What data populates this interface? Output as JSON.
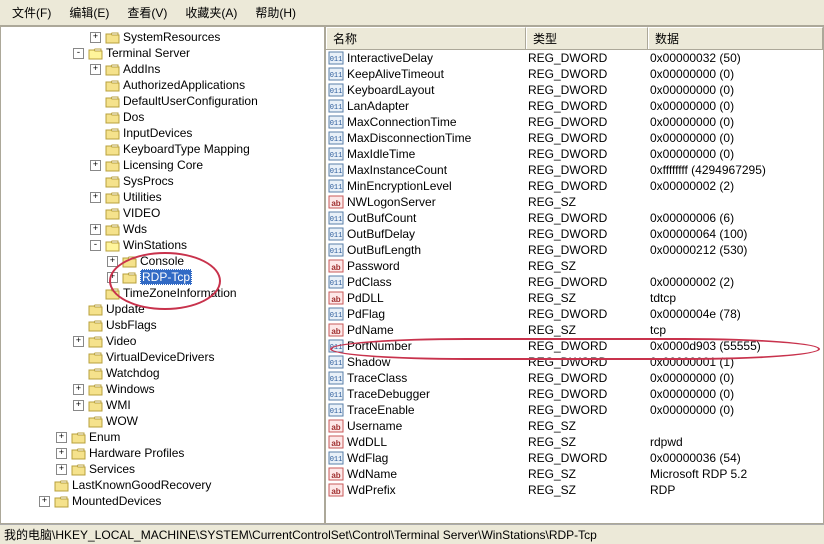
{
  "menu": {
    "file": "文件(F)",
    "edit": "编辑(E)",
    "view": "查看(V)",
    "favorites": "收藏夹(A)",
    "help": "帮助(H)"
  },
  "tree": [
    {
      "d": 5,
      "t": "+",
      "l": "SystemResources"
    },
    {
      "d": 4,
      "t": "-",
      "l": "Terminal Server"
    },
    {
      "d": 5,
      "t": "+",
      "l": "AddIns"
    },
    {
      "d": 5,
      "t": "",
      "l": "AuthorizedApplications"
    },
    {
      "d": 5,
      "t": "",
      "l": "DefaultUserConfiguration"
    },
    {
      "d": 5,
      "t": "",
      "l": "Dos"
    },
    {
      "d": 5,
      "t": "",
      "l": "InputDevices"
    },
    {
      "d": 5,
      "t": "",
      "l": "KeyboardType Mapping"
    },
    {
      "d": 5,
      "t": "+",
      "l": "Licensing Core"
    },
    {
      "d": 5,
      "t": "",
      "l": "SysProcs"
    },
    {
      "d": 5,
      "t": "+",
      "l": "Utilities"
    },
    {
      "d": 5,
      "t": "",
      "l": "VIDEO"
    },
    {
      "d": 5,
      "t": "+",
      "l": "Wds"
    },
    {
      "d": 5,
      "t": "-",
      "l": "WinStations"
    },
    {
      "d": 6,
      "t": "+",
      "l": "Console"
    },
    {
      "d": 6,
      "t": "+",
      "l": "RDP-Tcp",
      "sel": true
    },
    {
      "d": 5,
      "t": "",
      "l": "TimeZoneInformation"
    },
    {
      "d": 4,
      "t": "",
      "l": "Update"
    },
    {
      "d": 4,
      "t": "",
      "l": "UsbFlags"
    },
    {
      "d": 4,
      "t": "+",
      "l": "Video"
    },
    {
      "d": 4,
      "t": "",
      "l": "VirtualDeviceDrivers"
    },
    {
      "d": 4,
      "t": "",
      "l": "Watchdog"
    },
    {
      "d": 4,
      "t": "+",
      "l": "Windows"
    },
    {
      "d": 4,
      "t": "+",
      "l": "WMI"
    },
    {
      "d": 4,
      "t": "",
      "l": "WOW"
    },
    {
      "d": 3,
      "t": "+",
      "l": "Enum"
    },
    {
      "d": 3,
      "t": "+",
      "l": "Hardware Profiles"
    },
    {
      "d": 3,
      "t": "+",
      "l": "Services"
    },
    {
      "d": 2,
      "t": "",
      "l": "LastKnownGoodRecovery"
    },
    {
      "d": 2,
      "t": "+",
      "l": "MountedDevices"
    }
  ],
  "columns": {
    "name": "名称",
    "type": "类型",
    "data": "数据"
  },
  "values": [
    {
      "n": "InteractiveDelay",
      "t": "REG_DWORD",
      "d": "0x00000032 (50)",
      "k": "num"
    },
    {
      "n": "KeepAliveTimeout",
      "t": "REG_DWORD",
      "d": "0x00000000 (0)",
      "k": "num"
    },
    {
      "n": "KeyboardLayout",
      "t": "REG_DWORD",
      "d": "0x00000000 (0)",
      "k": "num"
    },
    {
      "n": "LanAdapter",
      "t": "REG_DWORD",
      "d": "0x00000000 (0)",
      "k": "num"
    },
    {
      "n": "MaxConnectionTime",
      "t": "REG_DWORD",
      "d": "0x00000000 (0)",
      "k": "num"
    },
    {
      "n": "MaxDisconnectionTime",
      "t": "REG_DWORD",
      "d": "0x00000000 (0)",
      "k": "num"
    },
    {
      "n": "MaxIdleTime",
      "t": "REG_DWORD",
      "d": "0x00000000 (0)",
      "k": "num"
    },
    {
      "n": "MaxInstanceCount",
      "t": "REG_DWORD",
      "d": "0xffffffff (4294967295)",
      "k": "num"
    },
    {
      "n": "MinEncryptionLevel",
      "t": "REG_DWORD",
      "d": "0x00000002 (2)",
      "k": "num"
    },
    {
      "n": "NWLogonServer",
      "t": "REG_SZ",
      "d": "",
      "k": "str"
    },
    {
      "n": "OutBufCount",
      "t": "REG_DWORD",
      "d": "0x00000006 (6)",
      "k": "num"
    },
    {
      "n": "OutBufDelay",
      "t": "REG_DWORD",
      "d": "0x00000064 (100)",
      "k": "num"
    },
    {
      "n": "OutBufLength",
      "t": "REG_DWORD",
      "d": "0x00000212 (530)",
      "k": "num"
    },
    {
      "n": "Password",
      "t": "REG_SZ",
      "d": "",
      "k": "str"
    },
    {
      "n": "PdClass",
      "t": "REG_DWORD",
      "d": "0x00000002 (2)",
      "k": "num"
    },
    {
      "n": "PdDLL",
      "t": "REG_SZ",
      "d": "tdtcp",
      "k": "str"
    },
    {
      "n": "PdFlag",
      "t": "REG_DWORD",
      "d": "0x0000004e (78)",
      "k": "num"
    },
    {
      "n": "PdName",
      "t": "REG_SZ",
      "d": "tcp",
      "k": "str"
    },
    {
      "n": "PortNumber",
      "t": "REG_DWORD",
      "d": "0x0000d903 (55555)",
      "k": "num"
    },
    {
      "n": "Shadow",
      "t": "REG_DWORD",
      "d": "0x00000001 (1)",
      "k": "num"
    },
    {
      "n": "TraceClass",
      "t": "REG_DWORD",
      "d": "0x00000000 (0)",
      "k": "num"
    },
    {
      "n": "TraceDebugger",
      "t": "REG_DWORD",
      "d": "0x00000000 (0)",
      "k": "num"
    },
    {
      "n": "TraceEnable",
      "t": "REG_DWORD",
      "d": "0x00000000 (0)",
      "k": "num"
    },
    {
      "n": "Username",
      "t": "REG_SZ",
      "d": "",
      "k": "str"
    },
    {
      "n": "WdDLL",
      "t": "REG_SZ",
      "d": "rdpwd",
      "k": "str"
    },
    {
      "n": "WdFlag",
      "t": "REG_DWORD",
      "d": "0x00000036 (54)",
      "k": "num"
    },
    {
      "n": "WdName",
      "t": "REG_SZ",
      "d": "Microsoft RDP 5.2",
      "k": "str"
    },
    {
      "n": "WdPrefix",
      "t": "REG_SZ",
      "d": "RDP",
      "k": "str"
    }
  ],
  "statusbar": "我的电脑\\HKEY_LOCAL_MACHINE\\SYSTEM\\CurrentControlSet\\Control\\Terminal Server\\WinStations\\RDP-Tcp"
}
